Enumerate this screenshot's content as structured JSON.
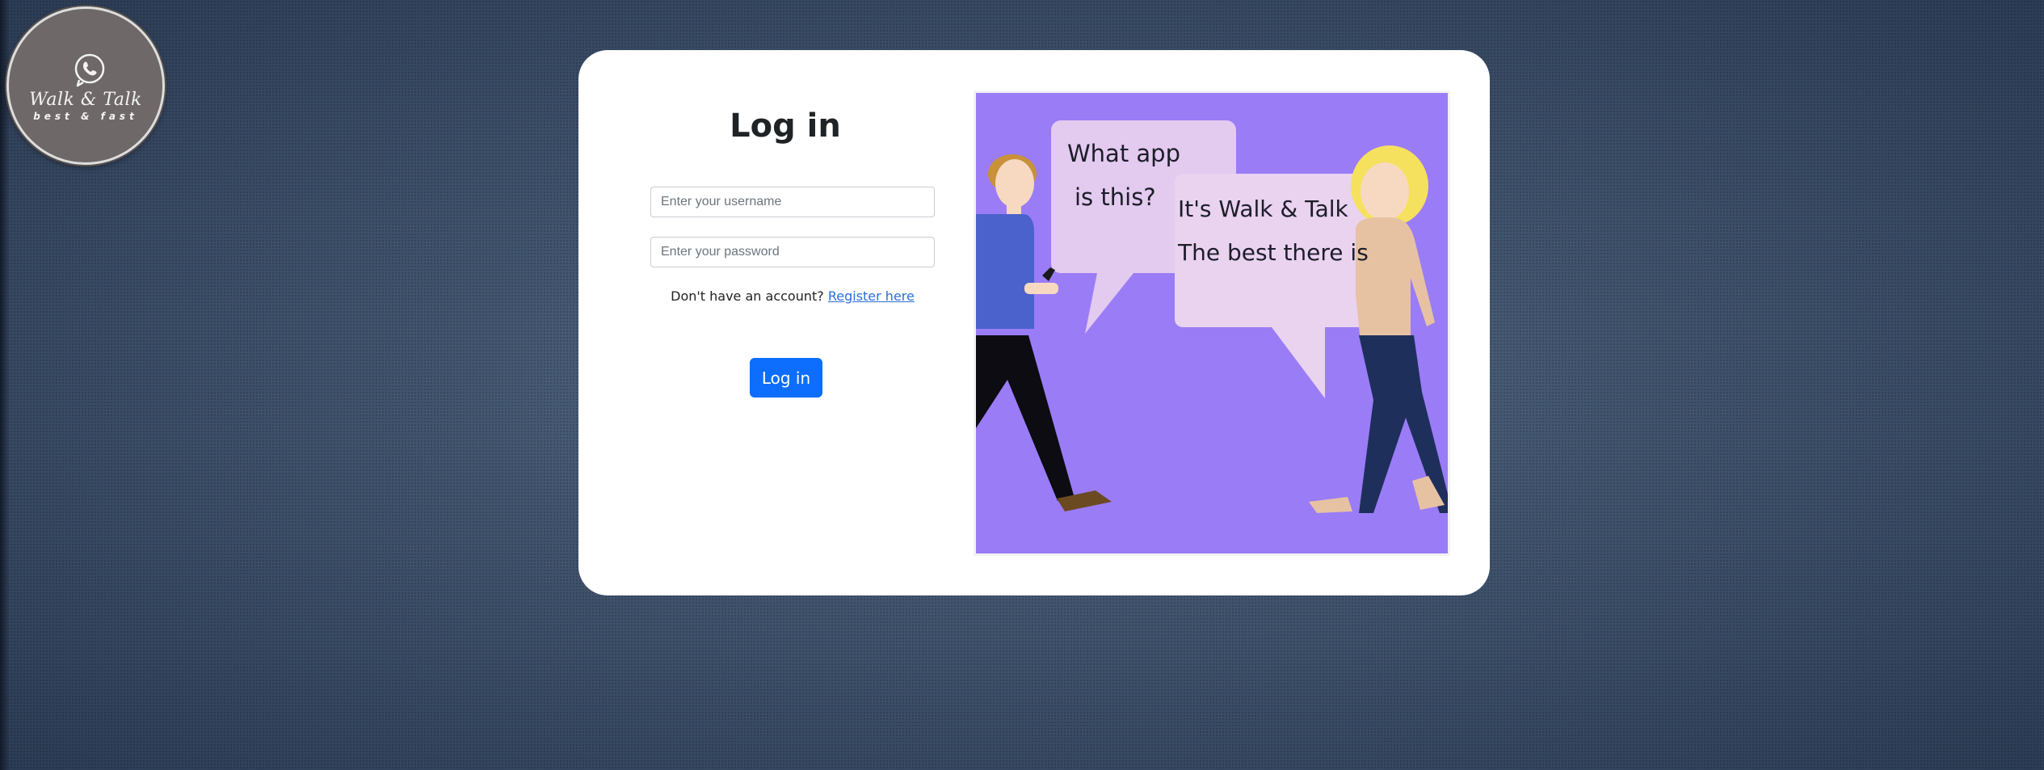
{
  "logo": {
    "title": "Walk & Talk",
    "tagline": "best & fast",
    "icon": "phone-icon"
  },
  "login": {
    "title": "Log in",
    "username_placeholder": "Enter your username",
    "password_placeholder": "Enter your password",
    "register_prompt": "Don't have an account?",
    "register_link": "Register here",
    "submit_label": "Log in"
  },
  "illustration": {
    "bubble_left_line1": "What app",
    "bubble_left_line2": "is this?",
    "bubble_right_line1": "It's Walk & Talk",
    "bubble_right_line2": "The best there is"
  },
  "colors": {
    "primary": "#0d6efd",
    "illustration_bg": "#9a7cf7",
    "bubble": "#e6cdee",
    "link": "#2a6fd6"
  }
}
